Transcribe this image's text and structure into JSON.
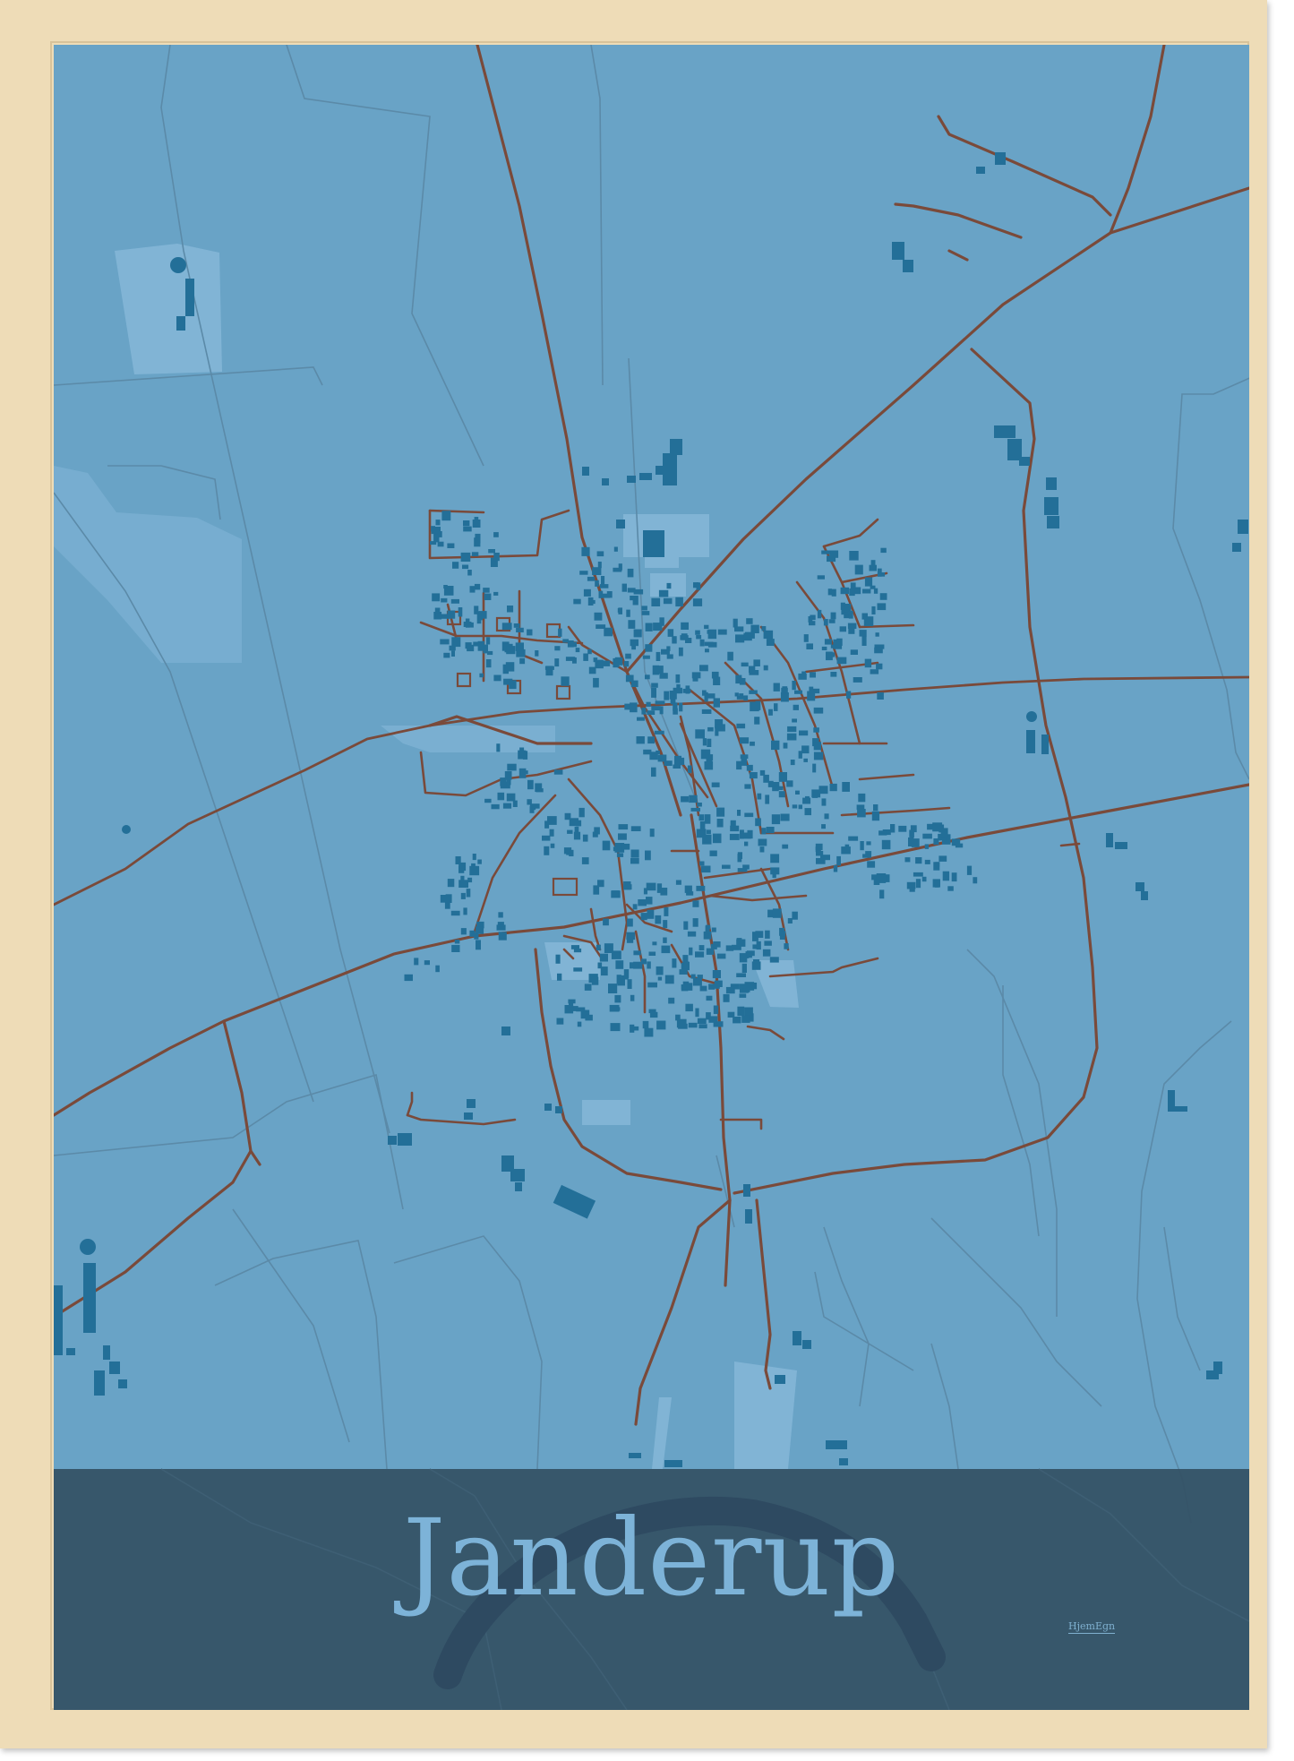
{
  "poster": {
    "title": "Janderup",
    "brand": "HjemEgn"
  },
  "colors": {
    "frame": "#eedcb7",
    "map_background": "#69a3c6",
    "roads": "#7a4a3a",
    "buildings": "#236f98",
    "areas": "#86b8d9",
    "title_band": "#345164",
    "title_text": "#7db3d8"
  },
  "icons": [
    "map-roads",
    "map-buildings",
    "map-areas"
  ]
}
